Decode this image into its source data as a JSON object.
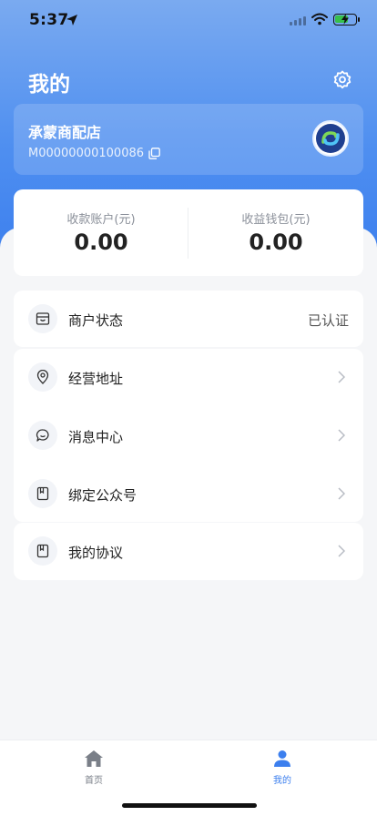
{
  "status_bar": {
    "time": "5:37"
  },
  "header": {
    "title": "我的"
  },
  "merchant": {
    "name": "承蒙商配店",
    "id": "M00000000100086"
  },
  "balances": [
    {
      "label": "收款账户(元)",
      "value": "0.00"
    },
    {
      "label": "收益钱包(元)",
      "value": "0.00"
    }
  ],
  "menu": {
    "merchant_status": {
      "label": "商户状态",
      "value": "已认证"
    },
    "business_address": {
      "label": "经营地址"
    },
    "message_center": {
      "label": "消息中心"
    },
    "bind_official_account": {
      "label": "绑定公众号"
    },
    "my_agreement": {
      "label": "我的协议"
    }
  },
  "tabbar": {
    "items": [
      {
        "label": "首页",
        "active": false
      },
      {
        "label": "我的",
        "active": true
      }
    ]
  },
  "colors": {
    "accent": "#3c7fee",
    "battery": "#37c04a"
  }
}
